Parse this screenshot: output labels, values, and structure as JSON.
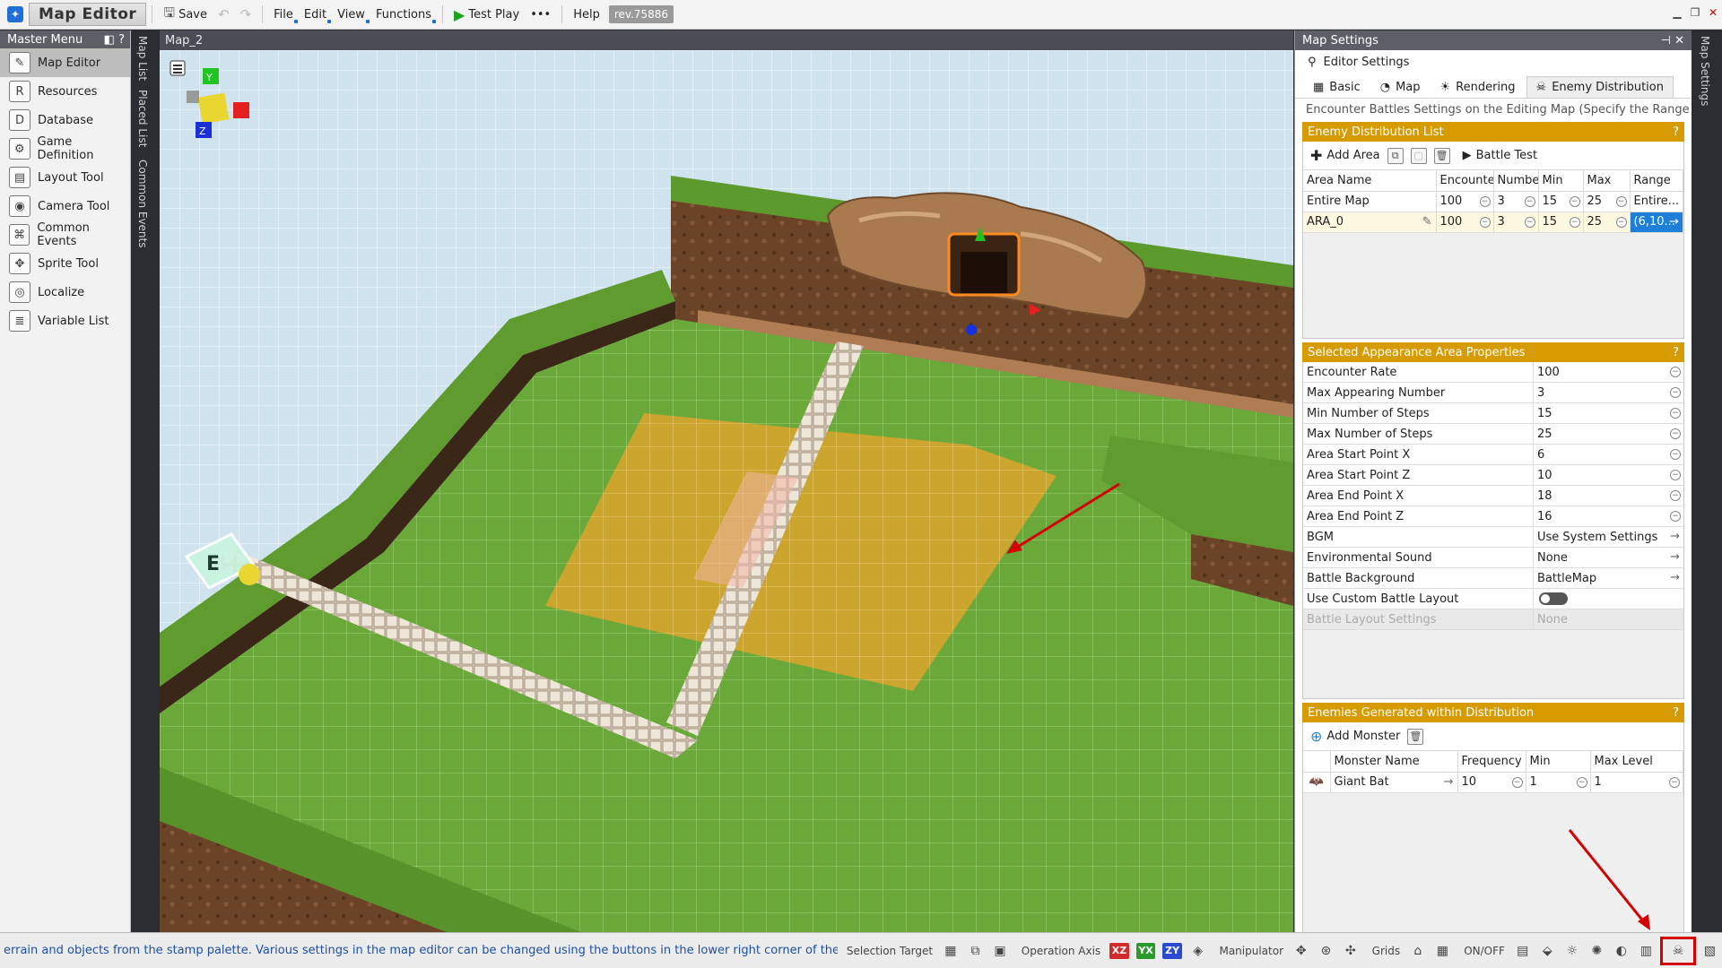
{
  "app": {
    "title": "Map Editor",
    "toolbar": {
      "save": "Save",
      "file": "File",
      "edit": "Edit",
      "view": "View",
      "functions": "Functions",
      "test_play": "Test Play",
      "more": "•••",
      "help": "Help",
      "revision": "rev.75886"
    }
  },
  "master_menu": {
    "title": "Master Menu",
    "items": [
      {
        "label": "Map Editor",
        "icon": "map-editor-icon"
      },
      {
        "label": "Resources",
        "icon": "resources-icon"
      },
      {
        "label": "Database",
        "icon": "database-icon"
      },
      {
        "label": "Game Definition",
        "icon": "game-definition-icon"
      },
      {
        "label": "Layout Tool",
        "icon": "layout-tool-icon"
      },
      {
        "label": "Camera Tool",
        "icon": "camera-tool-icon"
      },
      {
        "label": "Common Events",
        "icon": "common-events-icon"
      },
      {
        "label": "Sprite Tool",
        "icon": "sprite-tool-icon"
      },
      {
        "label": "Localize",
        "icon": "localize-icon"
      },
      {
        "label": "Variable List",
        "icon": "variable-list-icon"
      }
    ]
  },
  "side_tabs": {
    "map_list": "Map List",
    "placed_list": "Placed List",
    "common_events": "Common Events",
    "map_settings": "Map Settings"
  },
  "viewport": {
    "title": "Map_2",
    "axis_labels": {
      "y": "Y",
      "z": "Z"
    }
  },
  "settings": {
    "title": "Map Settings",
    "editor_settings": "Editor Settings",
    "tabs": [
      {
        "label": "Basic"
      },
      {
        "label": "Map"
      },
      {
        "label": "Rendering"
      },
      {
        "label": "Enemy Distribution"
      }
    ],
    "description": "Encounter Battles Settings on the Editing Map (Specify the Range",
    "distribution_list": {
      "title": "Enemy Distribution List",
      "help": "?",
      "add_area": "Add Area",
      "battle_test": "Battle Test",
      "columns": [
        "Area Name",
        "Encounte",
        "Numbe",
        "Min",
        "Max",
        "Range"
      ],
      "rows": [
        {
          "name": "Entire Map",
          "encounter": "100",
          "number": "3",
          "min": "15",
          "max": "25",
          "range": "Entire..."
        },
        {
          "name": "ARA_0",
          "encounter": "100",
          "number": "3",
          "min": "15",
          "max": "25",
          "range": "(6,10..."
        }
      ]
    },
    "area_props": {
      "title": "Selected Appearance Area Properties",
      "help": "?",
      "rows": [
        {
          "key": "Encounter Rate",
          "value": "100"
        },
        {
          "key": "Max Appearing Number",
          "value": "3"
        },
        {
          "key": "Min Number of Steps",
          "value": "15"
        },
        {
          "key": "Max Number of Steps",
          "value": "25"
        },
        {
          "key": "Area Start Point X",
          "value": "6"
        },
        {
          "key": "Area Start Point Z",
          "value": "10"
        },
        {
          "key": "Area End Point X",
          "value": "18"
        },
        {
          "key": "Area End Point Z",
          "value": "16"
        },
        {
          "key": "BGM",
          "value": "Use System Settings"
        },
        {
          "key": "Environmental Sound",
          "value": "None"
        },
        {
          "key": "Battle Background",
          "value": "BattleMap"
        },
        {
          "key": "Use Custom Battle Layout",
          "value": ""
        },
        {
          "key": "Battle Layout Settings",
          "value": "None"
        }
      ]
    },
    "enemies": {
      "title": "Enemies Generated within Distribution",
      "help": "?",
      "add_monster": "Add Monster",
      "columns": [
        "Monster Name",
        "Frequency",
        "Min",
        "Max Level"
      ],
      "rows": [
        {
          "name": "Giant Bat",
          "frequency": "10",
          "min": "1",
          "max": "1"
        }
      ]
    }
  },
  "statusbar": {
    "text": "errain and objects from the stamp palette.  Various settings in the map editor can be changed using the buttons in the lower right corner of the scre",
    "selection_target": "Selection Target",
    "operation_axis": "Operation Axis",
    "axes": [
      "XZ",
      "YX",
      "ZY"
    ],
    "manipulator": "Manipulator",
    "grids": "Grids",
    "on_off": "ON/OFF"
  },
  "colors": {
    "section_header": "#d69b00",
    "selection_blue": "#1e7fd8",
    "annotation_red": "#d40000",
    "grass": "#6aa83a",
    "area_highlight": "#e0a92a"
  }
}
